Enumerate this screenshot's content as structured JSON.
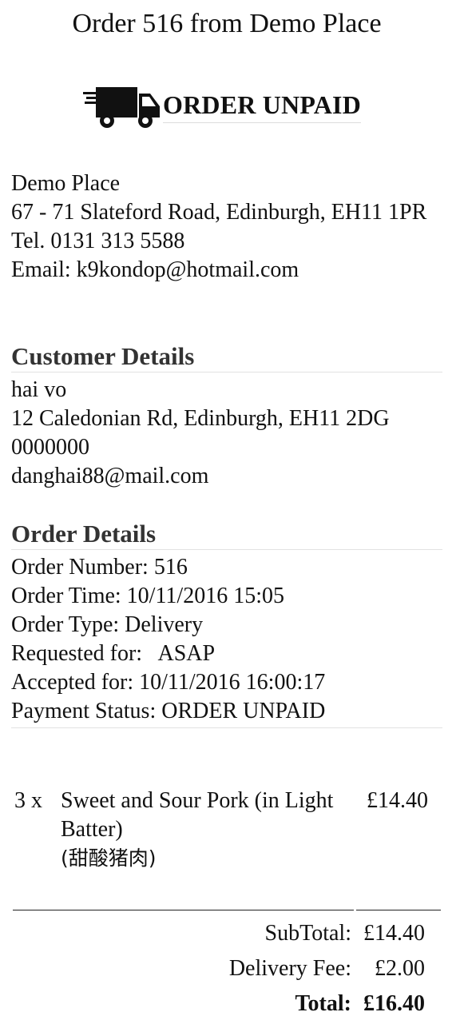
{
  "header": {
    "title": "Order 516 from Demo Place",
    "status": "ORDER UNPAID",
    "status_icon": "delivery-truck-icon"
  },
  "restaurant": {
    "name": "Demo Place",
    "address": "67 - 71 Slateford Road, Edinburgh, EH11 1PR",
    "phone": "Tel. 0131 313 5588",
    "email": "Email: k9kondop@hotmail.com"
  },
  "customer": {
    "heading": "Customer Details",
    "name": "hai vo",
    "address": "12 Caledonian Rd, Edinburgh, EH11 2DG",
    "phone": "0000000",
    "email": "danghai88@mail.com"
  },
  "order": {
    "heading": "Order Details",
    "number": "Order Number: 516",
    "time": "Order Time: 10/11/2016 15:05",
    "type": "Order Type: Delivery",
    "requested": "Requested for:   ASAP",
    "accepted": "Accepted for: 10/11/2016 16:00:17",
    "payment": "Payment Status: ORDER UNPAID"
  },
  "items": [
    {
      "qty": "3 x",
      "name": "Sweet and Sour Pork (in Light Batter)",
      "subname": "(甜酸猪肉)",
      "price": "£14.40"
    }
  ],
  "totals": {
    "subtotal_label": "SubTotal:",
    "subtotal": "£14.40",
    "delivery_label": "Delivery Fee:",
    "delivery": "£2.00",
    "total_label": "Total:",
    "total": "£16.40"
  }
}
